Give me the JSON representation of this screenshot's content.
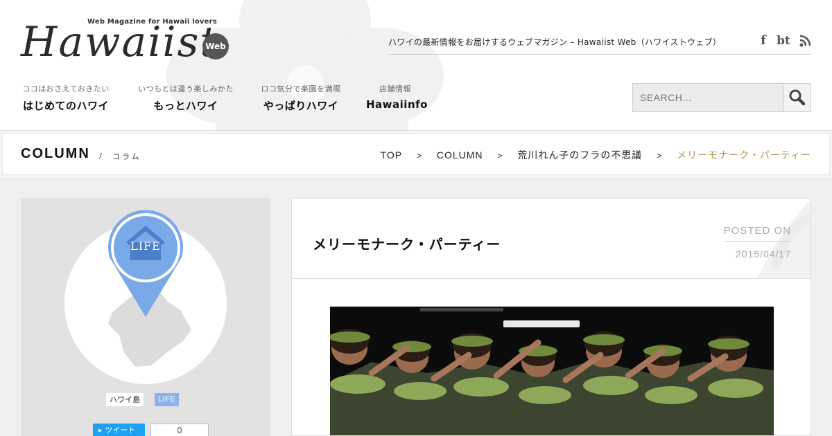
{
  "header": {
    "logo_tagline": "Web Magazine for Hawaii lovers",
    "logo_text": "Hawaiist",
    "logo_badge": "Web",
    "site_tagline": "ハワイの最新情報をお届けするウェブマガジン – Hawaiist Web（ハワイストウェブ）",
    "social_icons": [
      "facebook-icon",
      "bt-icon",
      "rss-icon"
    ],
    "social_labels": {
      "facebook": "f",
      "bt": "bt"
    }
  },
  "nav": [
    {
      "sub": "ココはおさえておきたい",
      "label": "はじめてのハワイ"
    },
    {
      "sub": "いつもとは違う楽しみかた",
      "label": "もっとハワイ"
    },
    {
      "sub": "ロコ気分で楽園を満喫",
      "label": "やっぱりハワイ"
    },
    {
      "sub": "店舗情報",
      "label": "Hawaiinfo"
    }
  ],
  "search": {
    "placeholder": "SEARCH..."
  },
  "section": {
    "title": "COLUMN",
    "slash": "/",
    "subtitle": "コラム"
  },
  "breadcrumb": {
    "items": [
      "TOP",
      "COLUMN",
      "荒川れん子のフラの不思議",
      "メリーモナーク・パーティー"
    ],
    "separator": ">"
  },
  "sidebar": {
    "pin_label": "LIFE",
    "tags": [
      "ハワイ島",
      "LIFE"
    ],
    "tweet_label": "ツイート",
    "tweet_count": "0"
  },
  "article": {
    "title": "メリーモナーク・パーティー",
    "posted_on_label": "POSTED ON",
    "date": "2015/04/17"
  },
  "colors": {
    "accent_gold": "#b39551",
    "pin_blue": "#7aa9e8",
    "tag_blue": "#8db4e6",
    "twitter": "#1da1f2"
  }
}
